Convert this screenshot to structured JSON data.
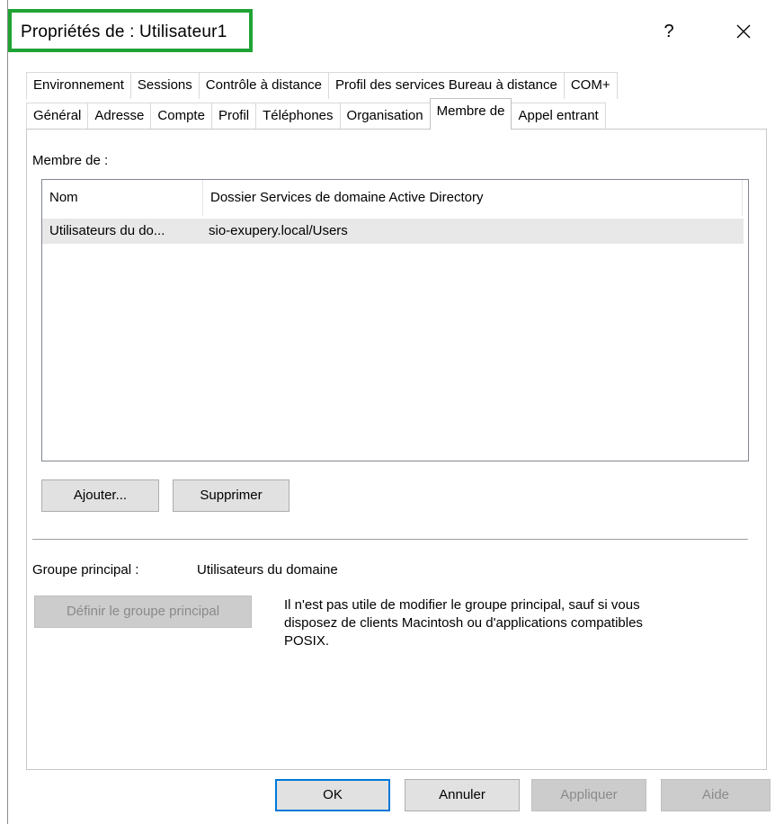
{
  "window": {
    "title": "Propriétés de : Utilisateur1",
    "help_glyph": "?",
    "close_icon": "close-icon"
  },
  "tabs": {
    "top_row": [
      {
        "label": "Environnement"
      },
      {
        "label": "Sessions"
      },
      {
        "label": "Contrôle à distance"
      },
      {
        "label": "Profil des services Bureau à distance"
      },
      {
        "label": "COM+"
      }
    ],
    "bottom_row": [
      {
        "label": "Général"
      },
      {
        "label": "Adresse"
      },
      {
        "label": "Compte"
      },
      {
        "label": "Profil"
      },
      {
        "label": "Téléphones"
      },
      {
        "label": "Organisation"
      },
      {
        "label": "Membre de",
        "active": true
      },
      {
        "label": "Appel entrant"
      }
    ]
  },
  "member_of": {
    "section_label": "Membre de :",
    "columns": [
      "Nom",
      "Dossier Services de domaine Active Directory"
    ],
    "rows": [
      {
        "name": "Utilisateurs du do...",
        "folder": "sio-exupery.local/Users"
      }
    ],
    "add_button": "Ajouter...",
    "remove_button": "Supprimer"
  },
  "primary_group": {
    "label": "Groupe principal :",
    "value": "Utilisateurs du domaine",
    "set_button": "Définir le groupe principal",
    "info_line1": "Il n'est pas utile de modifier le groupe principal, sauf si vous",
    "info_line2": "disposez de clients Macintosh ou d'applications compatibles",
    "info_line3": "POSIX."
  },
  "footer": {
    "ok": "OK",
    "cancel": "Annuler",
    "apply": "Appliquer",
    "help": "Aide"
  },
  "colors": {
    "title_highlight": "#1fa334",
    "default_button_border": "#0078d7",
    "selected_row": "#e8e8e8"
  }
}
